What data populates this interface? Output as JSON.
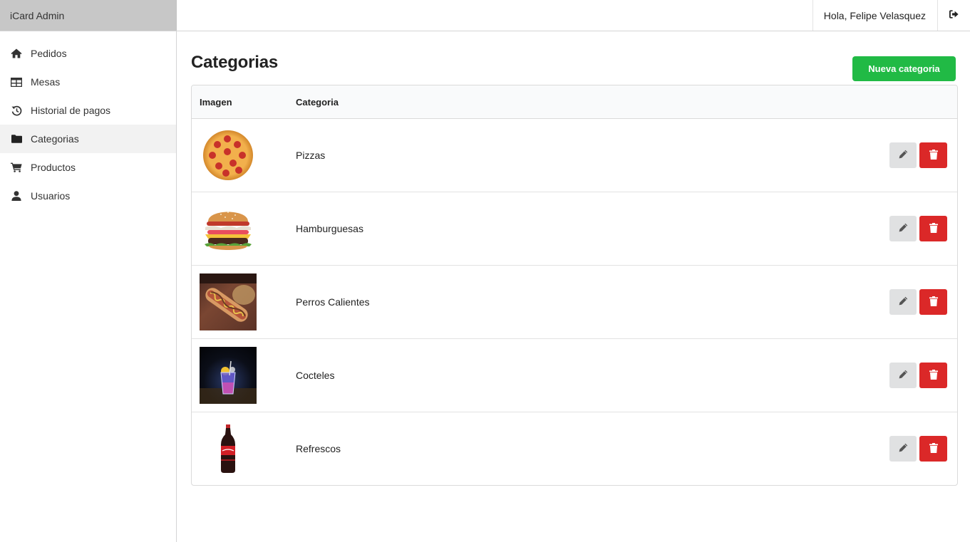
{
  "app": {
    "title": "iCard Admin"
  },
  "header": {
    "greeting": "Hola, Felipe Velasquez",
    "logout_icon": "sign-out-icon"
  },
  "sidebar": {
    "items": [
      {
        "label": "Pedidos",
        "icon": "home-icon",
        "active": false
      },
      {
        "label": "Mesas",
        "icon": "table-icon",
        "active": false
      },
      {
        "label": "Historial de pagos",
        "icon": "history-icon",
        "active": false
      },
      {
        "label": "Categorias",
        "icon": "folder-icon",
        "active": true
      },
      {
        "label": "Productos",
        "icon": "cart-icon",
        "active": false
      },
      {
        "label": "Usuarios",
        "icon": "user-icon",
        "active": false
      }
    ]
  },
  "page": {
    "title": "Categorias",
    "new_button_label": "Nueva categoria"
  },
  "table": {
    "columns": {
      "image": "Imagen",
      "category": "Categoria"
    },
    "rows": [
      {
        "name": "Pizzas",
        "image": "pizza"
      },
      {
        "name": "Hamburguesas",
        "image": "burger"
      },
      {
        "name": "Perros Calientes",
        "image": "hotdog"
      },
      {
        "name": "Cocteles",
        "image": "cocktail"
      },
      {
        "name": "Refrescos",
        "image": "soda"
      }
    ]
  },
  "colors": {
    "primary_green": "#21ba45",
    "danger_red": "#db2828",
    "brand_bg": "#c7c7c7",
    "edit_gray": "#e0e1e2"
  }
}
